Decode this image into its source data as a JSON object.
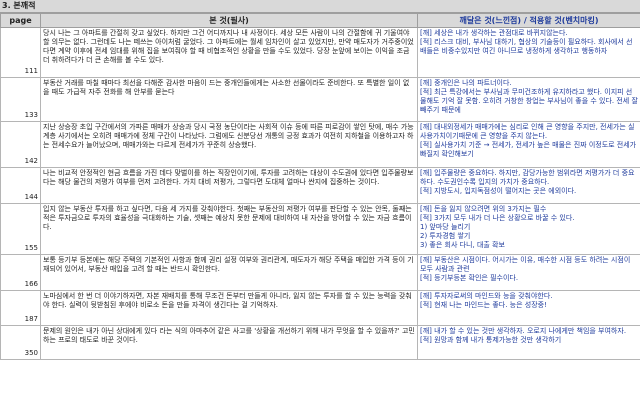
{
  "section_title": "3. 본깨적",
  "headers": {
    "page": "page",
    "body": "본 것(필사)",
    "note": "깨달은 것(느낀점) / 적용할 것(벤치마킹)"
  },
  "rows": [
    {
      "page": "111",
      "body": "당시 나는 그 아파트를 간절히 갖고 싶었다. 하지만 그건 어디까지나 내 사정이다. 세상 모든 사람이 나의 간절함에 귀 기울여야할 의무는 없다. 그런데도 나는 떼쓰는 아이처럼 굴었다. 그 아파트에는 월세 임차인이 살고 있었지만, 만약 매도자가 거주중이었다면 계약 이후에 전세 임대를 위해 집을 보여줘야 할 때 비협조적인 상황을 만들 수도 있었다. 당장 눈앞에 보이는 이익을 조금 더 취하려다가 더 큰 손해를 볼 수도 있다.",
      "notes": [
        "[깨] 세상은 내가 생각하는 관점대로 바뀌지않는다.",
        "[적] 리스크 대비, 부사님 대하기, 협상의 기술등이 필요하다. 회사에서 선배들은 비중수있지만 여긴 아니므로 냉정하게 생각하고 행동하자"
      ]
    },
    {
      "page": "133",
      "body": "부동산 거래를 마칠 때마다 최선을 다해준 감사한 마음이 드는 중개인들에게는 사소한 선물이라도 준비한다. 또 특별한 일이 없을 때도 가급적 자주 전화를 해 안부를 묻는다",
      "notes": [
        "[깨] 중개인은 나의 파트너이다.",
        "[적] 최근 특강에서는 부사님과 무미건조하게 유지하라고 했다. 이지피 선물해도 기억 잘 못함. 오히려 거창한 창업는 부사님이 좋을 수 있다. 전세 잘 빼주기 때문에"
      ]
    },
    {
      "page": "142",
      "body": "지난 상승장 초입 구간에서의 가파른 매매가 상승과 당시 국정 농단이라는 사회적 이슈 등에 따른 피로감이 쌓인 탓에, 매수 가능 계층 사기에서는 오히려 매매가에 정체 구간이 나타났다. 그럼에도 신분당선 개통의 긍정 효과가 여전히 지하철을 이용하고자 하는 전세수요가 늘어났으며, 매매가와는 다르게 전세가가 꾸준히 상승했다.",
      "notes": [
        "[깨] 대내외정세가 매매가에는 심리로 인해 큰 영향을 주지만, 전세가는 실사용가치이기때문에 큰 영향을 주지 않는다.",
        "[적] 실사용가치 기준 → 전세가, 전세가 높은 매물은 진짜 이정도로 전세가 빠질지 확인해보기"
      ]
    },
    {
      "page": "144",
      "body": "나는 비교적 안정적인 현금 흐름을 가진 데다 맞벌이를 하는 직장인이기에, 투자를 고려하는 대상이 수도권에 있다면 입주물량보다는 해당 물건의 저평가 여부를 먼저 고려한다. 가치 대비 저평가, 그렇다면 도대체 얼마나 싼지에 집중하는 것이다.",
      "notes": [
        "[깨] 입주물량은 중요하다. 하지만, 감당가능한 범위라면 저평가가 더 중요하다. 수도권인수록 입지의 가치가 중요하다.",
        "[적] 지방도시, 입지독점성이 떨어지는 곳은 에외이다."
      ]
    },
    {
      "page": "155",
      "body": "입지 않는 부동산 투자를 하고 싶다면, 다음 세 가지를 갖춰야한다. 첫째는 부동산의 저평가 여부를 판단할 수 있는 안목, 둘째는 적은 투자금으로 투자의 효율성을 극대화하는 기술, 셋째는 예상치 못한 문제에 대비하여 내 자산을 방어할 수 있는 자금 흐름이다.",
      "notes": [
        "[깨] 돈을 잃지 않으려면 위의 3가지는 필수",
        "[적] 3가지 모두 내가 더 나은 상황으로 바꿀 수 있다.",
        "1) 앞마당 늘리기",
        "2) 투자경험 쌓기",
        "3) 좋은 회사 다니, 대출 확보"
      ]
    },
    {
      "page": "166",
      "body": "보통 등기부 등본에는 해당 주택의 기본적인 사항과 함께 권리 설정 여부와 권리관계, 매도자가 해당 주택을 매입한 가격 등이 기재되어 있어서, 부동산 매입을 고려 할 때는 반드시 확인한다.",
      "notes": [
        "[깨] 부동산은 시점이다. 어시가는 이유, 매수한 시점 등도 하려는 시점이 모두 사람과 관련",
        "[적] 등기부등본 확인은 필수이다."
      ]
    },
    {
      "page": "187",
      "body": "노마심에서 한 번 더 이야기하자면, 자본 재배치를 통해 무조건 돈부터 만들게 아니라, 잃지 않는 투자를 할 수 있는 능력을 갖춰야 한다. 실력이 뒷받침된 후에야 비로소 돈을 만들 자격이 생긴다는 걸 기억하자.",
      "notes": [
        "[깨] 투자자로써의 마인드와 능을 갖춰야한다.",
        "[적] 현재 나는 마인드는 좋다. 능은 성장중!"
      ]
    },
    {
      "page": "350",
      "body": "문제의 원인은 내가 아닌 상대에게 있다 라는 식의 아마추어 같은 사고를 '상황을 개선하기 위해 내가 무엇을 할 수 있을까?' 고민하는 프로의 태도로 바꾼 것이다.",
      "notes": [
        "[깨] 내가 할 수 있는 것만 생각하자. 오로지 나에게만 책임을 부여하자.",
        "[적] 원망과 함께 내가 통제가능한 것만 생각하기"
      ]
    }
  ]
}
